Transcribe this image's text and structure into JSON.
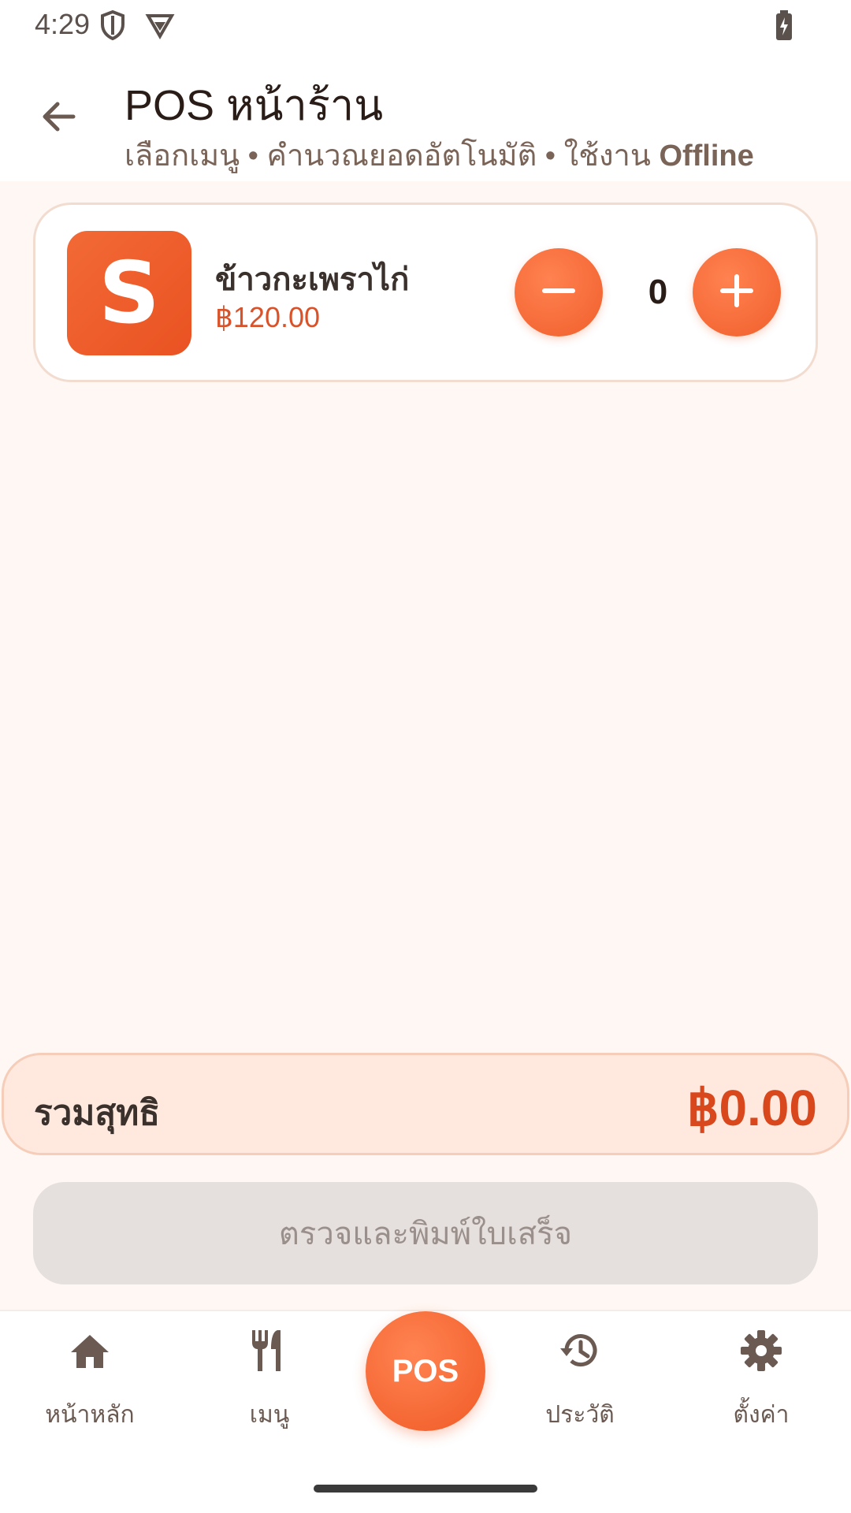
{
  "status_bar": {
    "time": "4:29",
    "icons": [
      "shield-icon",
      "vpn-icon",
      "battery-charging-icon"
    ]
  },
  "app_bar": {
    "title": "POS หน้าร้าน",
    "subtitle_prefix": "เลือกเมนู • คำนวณยอดอัตโนมัติ • ใช้งาน ",
    "subtitle_bold": "Offline"
  },
  "items": [
    {
      "logo_letter": "S",
      "name": "ข้าวกะเพราไก่",
      "price": "฿120.00",
      "quantity": "0"
    }
  ],
  "summary": {
    "label": "รวมสุทธิ",
    "total": "฿0.00"
  },
  "actions": {
    "print_label": "ตรวจและพิมพ์ใบเสร็จ"
  },
  "bottom_nav": {
    "home": "หน้าหลัก",
    "menu": "เมนู",
    "pos": "POS",
    "history": "ประวัติ",
    "settings": "ตั้งค่า"
  },
  "colors": {
    "accent": "#f05f2c",
    "background": "#fff7f3",
    "total_text": "#d9471d",
    "disabled_button": "#e5e0dd"
  }
}
